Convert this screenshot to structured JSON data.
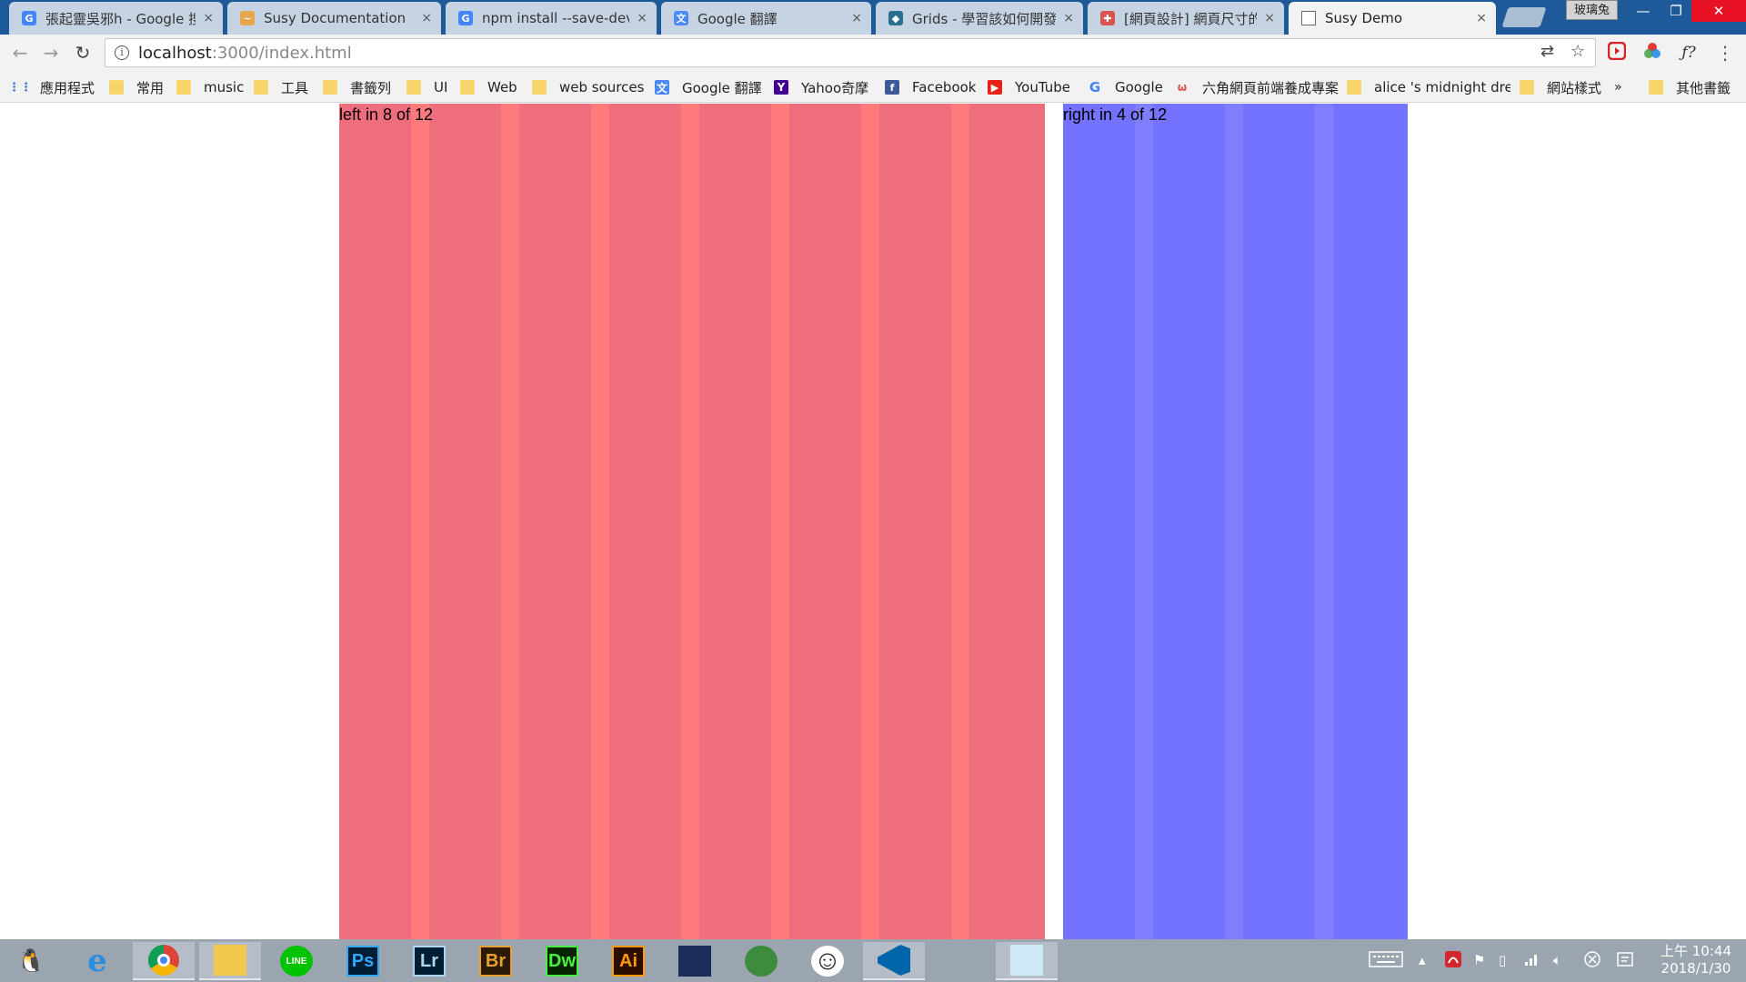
{
  "browser": {
    "tabs": [
      {
        "title": "張起靈吳邪h - Google 搜尋",
        "icon": "google-icon",
        "active": false
      },
      {
        "title": "Susy Documentation",
        "icon": "susy-icon",
        "active": false
      },
      {
        "title": "npm install --save-dev",
        "icon": "google-icon",
        "active": false
      },
      {
        "title": "Google 翻譯",
        "icon": "google-translate-icon",
        "active": false
      },
      {
        "title": "Grids - 學習該如何開發",
        "icon": "grids-icon",
        "active": false
      },
      {
        "title": "[網頁設計] 網頁尺寸的設定",
        "icon": "site-icon",
        "active": false
      },
      {
        "title": "Susy Demo",
        "icon": "page-icon",
        "active": true
      }
    ],
    "tab_close": "×",
    "profile_name": "玻璃兔",
    "window": {
      "minimize": "—",
      "maximize": "❐",
      "close": "✕"
    },
    "url_host": "localhost",
    "url_path": ":3000/index.html",
    "info_glyph": "i",
    "nav": {
      "back": "←",
      "forward": "→",
      "reload": "↻"
    },
    "omni_icons": {
      "translate": "⇄",
      "star": "☆"
    },
    "extensions": {
      "menu": "⋮",
      "fquery": "ƒ?"
    }
  },
  "bookmarks": [
    {
      "label": "應用程式",
      "icon": "apps-grid-icon"
    },
    {
      "label": "常用",
      "icon": "folder-icon"
    },
    {
      "label": "music",
      "icon": "folder-icon"
    },
    {
      "label": "工具",
      "icon": "folder-icon"
    },
    {
      "label": "書籤列",
      "icon": "folder-icon"
    },
    {
      "label": "UI",
      "icon": "folder-icon"
    },
    {
      "label": "Web",
      "icon": "folder-icon"
    },
    {
      "label": "web sources",
      "icon": "folder-icon"
    },
    {
      "label": "Google 翻譯",
      "icon": "google-translate-icon"
    },
    {
      "label": "Yahoo奇摩",
      "icon": "yahoo-icon"
    },
    {
      "label": "Facebook",
      "icon": "facebook-icon"
    },
    {
      "label": "YouTube",
      "icon": "youtube-icon"
    },
    {
      "label": "Google",
      "icon": "google-icon"
    },
    {
      "label": "六角網頁前端養成專案",
      "icon": "hexschool-icon"
    },
    {
      "label": "alice 's midnight dream",
      "icon": "folder-icon"
    },
    {
      "label": "網站樣式",
      "icon": "folder-icon"
    }
  ],
  "bookmarks_overflow": "»",
  "other_bookmarks": "其他書籤",
  "content": {
    "left_label": "left in 8 of 12",
    "right_label": "right in 4 of 12",
    "colors": {
      "left_gutter": "#ff7b7b",
      "left_column": "#ef6e7e",
      "right_gutter": "#7f7fff",
      "right_column": "#7373ff"
    }
  },
  "taskbar": {
    "apps": [
      {
        "name": "penguin-app-icon",
        "label": "🐧"
      },
      {
        "name": "internet-explorer-icon",
        "label": "e"
      },
      {
        "name": "chrome-icon",
        "label": ""
      },
      {
        "name": "file-explorer-icon",
        "label": ""
      },
      {
        "name": "line-icon",
        "label": "LINE"
      },
      {
        "name": "photoshop-icon",
        "label": "Ps"
      },
      {
        "name": "lightroom-icon",
        "label": "Lr"
      },
      {
        "name": "bridge-icon",
        "label": "Br"
      },
      {
        "name": "dreamweaver-icon",
        "label": "Dw"
      },
      {
        "name": "illustrator-icon",
        "label": "Ai"
      },
      {
        "name": "video-app-icon",
        "label": ""
      },
      {
        "name": "globe-app-icon",
        "label": ""
      },
      {
        "name": "smiley-app-icon",
        "label": "☺"
      },
      {
        "name": "vscode-icon",
        "label": ""
      },
      {
        "name": "paint-app-icon",
        "label": ""
      },
      {
        "name": "notepad-app-icon",
        "label": ""
      }
    ],
    "time": "上午 10:44",
    "date": "2018/1/30"
  }
}
